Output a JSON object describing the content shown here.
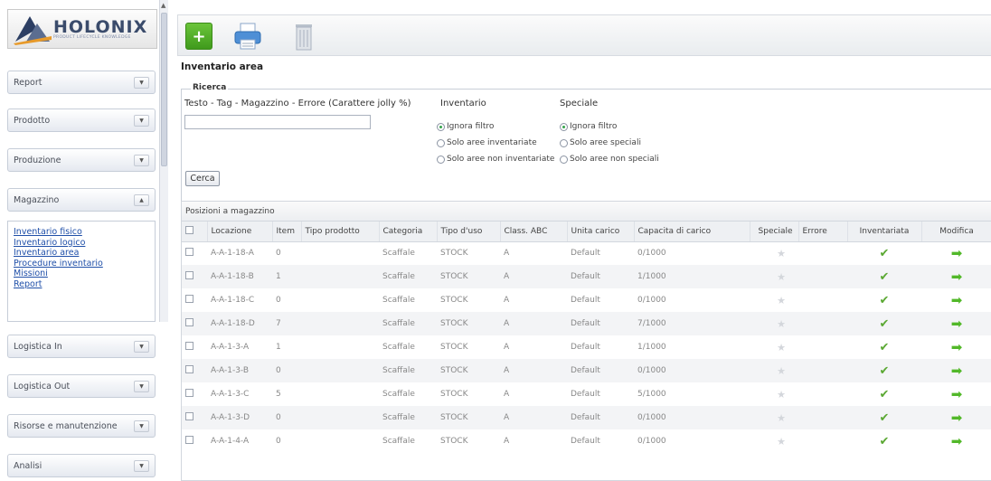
{
  "brand": {
    "name": "HOLONIX",
    "tagline": "PRODUCT LIFECYCLE KNOWLEDGE"
  },
  "sidebar": {
    "panels": [
      {
        "label": "Report"
      },
      {
        "label": "Prodotto"
      },
      {
        "label": "Produzione"
      },
      {
        "label": "Magazzino"
      },
      {
        "label": "Logistica In"
      },
      {
        "label": "Logistica Out"
      },
      {
        "label": "Risorse e manutenzione"
      },
      {
        "label": "Analisi"
      }
    ],
    "submenu": [
      "Inventario fisico",
      "Inventario logico",
      "Inventario area",
      "Procedure inventario",
      "Missioni",
      "Report"
    ]
  },
  "page": {
    "title": "Inventario area"
  },
  "search": {
    "legend": "Ricerca",
    "label": "Testo - Tag - Magazzino - Errore (Carattere jolly %)",
    "value": "",
    "inventario": {
      "title": "Inventario",
      "options": [
        "Ignora filtro",
        "Solo aree inventariate",
        "Solo aree non inventariate"
      ],
      "selected": 0
    },
    "speciale": {
      "title": "Speciale",
      "options": [
        "Ignora filtro",
        "Solo aree speciali",
        "Solo aree non speciali"
      ],
      "selected": 0
    },
    "button": "Cerca"
  },
  "grid": {
    "title": "Posizioni a magazzino",
    "columns": [
      "Locazione",
      "Item",
      "Tipo prodotto",
      "Categoria",
      "Tipo d'uso",
      "Class. ABC",
      "Unita carico",
      "Capacita di carico",
      "Speciale",
      "Errore",
      "Inventariata",
      "Modifica"
    ],
    "rows": [
      {
        "locazione": "A-A-1-18-A",
        "item": "0",
        "tipo_prodotto": "",
        "categoria": "Scaffale",
        "tipo_uso": "STOCK",
        "abc": "A",
        "unita": "Default",
        "capacita": "0/1000"
      },
      {
        "locazione": "A-A-1-18-B",
        "item": "1",
        "tipo_prodotto": "",
        "categoria": "Scaffale",
        "tipo_uso": "STOCK",
        "abc": "A",
        "unita": "Default",
        "capacita": "1/1000"
      },
      {
        "locazione": "A-A-1-18-C",
        "item": "0",
        "tipo_prodotto": "",
        "categoria": "Scaffale",
        "tipo_uso": "STOCK",
        "abc": "A",
        "unita": "Default",
        "capacita": "0/1000"
      },
      {
        "locazione": "A-A-1-18-D",
        "item": "7",
        "tipo_prodotto": "",
        "categoria": "Scaffale",
        "tipo_uso": "STOCK",
        "abc": "A",
        "unita": "Default",
        "capacita": "7/1000"
      },
      {
        "locazione": "A-A-1-3-A",
        "item": "1",
        "tipo_prodotto": "",
        "categoria": "Scaffale",
        "tipo_uso": "STOCK",
        "abc": "A",
        "unita": "Default",
        "capacita": "1/1000"
      },
      {
        "locazione": "A-A-1-3-B",
        "item": "0",
        "tipo_prodotto": "",
        "categoria": "Scaffale",
        "tipo_uso": "STOCK",
        "abc": "A",
        "unita": "Default",
        "capacita": "0/1000"
      },
      {
        "locazione": "A-A-1-3-C",
        "item": "5",
        "tipo_prodotto": "",
        "categoria": "Scaffale",
        "tipo_uso": "STOCK",
        "abc": "A",
        "unita": "Default",
        "capacita": "5/1000"
      },
      {
        "locazione": "A-A-1-3-D",
        "item": "0",
        "tipo_prodotto": "",
        "categoria": "Scaffale",
        "tipo_uso": "STOCK",
        "abc": "A",
        "unita": "Default",
        "capacita": "0/1000"
      },
      {
        "locazione": "A-A-1-4-A",
        "item": "0",
        "tipo_prodotto": "",
        "categoria": "Scaffale",
        "tipo_uso": "STOCK",
        "abc": "A",
        "unita": "Default",
        "capacita": "0/1000"
      }
    ]
  },
  "icons": {
    "add": "plus-icon",
    "print": "printer-icon",
    "delete": "trash-icon",
    "speciale": "star-icon",
    "inventariata": "check-icon",
    "modifica": "arrow-right-icon"
  },
  "colors": {
    "accent_green": "#4caf28",
    "link_blue": "#1f4fa8",
    "brand_navy": "#3a4b6b"
  }
}
